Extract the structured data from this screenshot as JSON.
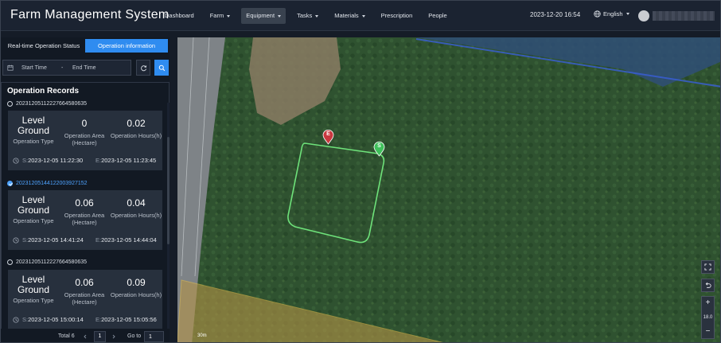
{
  "app": {
    "title": "Farm Management System"
  },
  "nav": {
    "items": [
      {
        "label": "Dashboard",
        "dropdown": false,
        "active": false
      },
      {
        "label": "Farm",
        "dropdown": true,
        "active": false
      },
      {
        "label": "Equipment",
        "dropdown": true,
        "active": true
      },
      {
        "label": "Tasks",
        "dropdown": true,
        "active": false
      },
      {
        "label": "Materials",
        "dropdown": true,
        "active": false
      },
      {
        "label": "Prescription",
        "dropdown": false,
        "active": false
      },
      {
        "label": "People",
        "dropdown": false,
        "active": false
      }
    ]
  },
  "header": {
    "datetime": "2023-12-20 16:54",
    "language": "English"
  },
  "sidebar": {
    "tabs": [
      {
        "label": "Real-time Operation Status",
        "active": false
      },
      {
        "label": "Operation information",
        "active": true
      }
    ],
    "filter": {
      "start_placeholder": "Start Time",
      "separator": "-",
      "end_placeholder": "End Time"
    },
    "records_title": "Operation Records",
    "records": [
      {
        "id": "20231205112227664580635",
        "selected": false,
        "operation_type": "Level Ground",
        "operation_type_label": "Operation Type",
        "area": "0",
        "area_label": "Operation Area (Hectare)",
        "hours": "0.02",
        "hours_label": "Operation Hours(h)",
        "start_prefix": "S:",
        "start": "2023-12-05 11:22:30",
        "end_prefix": "E:",
        "end": "2023-12-05 11:23:45"
      },
      {
        "id": "20231205144122003927152",
        "selected": true,
        "operation_type": "Level Ground",
        "operation_type_label": "Operation Type",
        "area": "0.06",
        "area_label": "Operation Area (Hectare)",
        "hours": "0.04",
        "hours_label": "Operation Hours(h)",
        "start_prefix": "S:",
        "start": "2023-12-05 14:41:24",
        "end_prefix": "E:",
        "end": "2023-12-05 14:44:04"
      },
      {
        "id": "20231205112227664580635",
        "selected": false,
        "operation_type": "Level Ground",
        "operation_type_label": "Operation Type",
        "area": "0.06",
        "area_label": "Operation Area (Hectare)",
        "hours": "0.09",
        "hours_label": "Operation Hours(h)",
        "start_prefix": "S:",
        "start": "2023-12-05 15:00:14",
        "end_prefix": "E:",
        "end": "2023-12-05 15:05:56"
      }
    ],
    "pagination": {
      "total": "Total 6",
      "page": "1",
      "goto_label": "Go to",
      "goto_value": "1"
    }
  },
  "map": {
    "scale": "30m",
    "zoom": "18.0",
    "markers": {
      "start": "S",
      "end": "E"
    },
    "colors": {
      "track": "#6ee27a",
      "start_marker": "#3fbf5a",
      "end_marker": "#c8383f",
      "field_boundary": "#e0b94a"
    }
  },
  "icons": {
    "refresh": "refresh-icon",
    "search": "search-icon",
    "calendar": "calendar-icon",
    "clock": "clock-icon",
    "globe": "globe-icon",
    "fullscreen": "fullscreen-icon",
    "reset": "reset-view-icon"
  }
}
